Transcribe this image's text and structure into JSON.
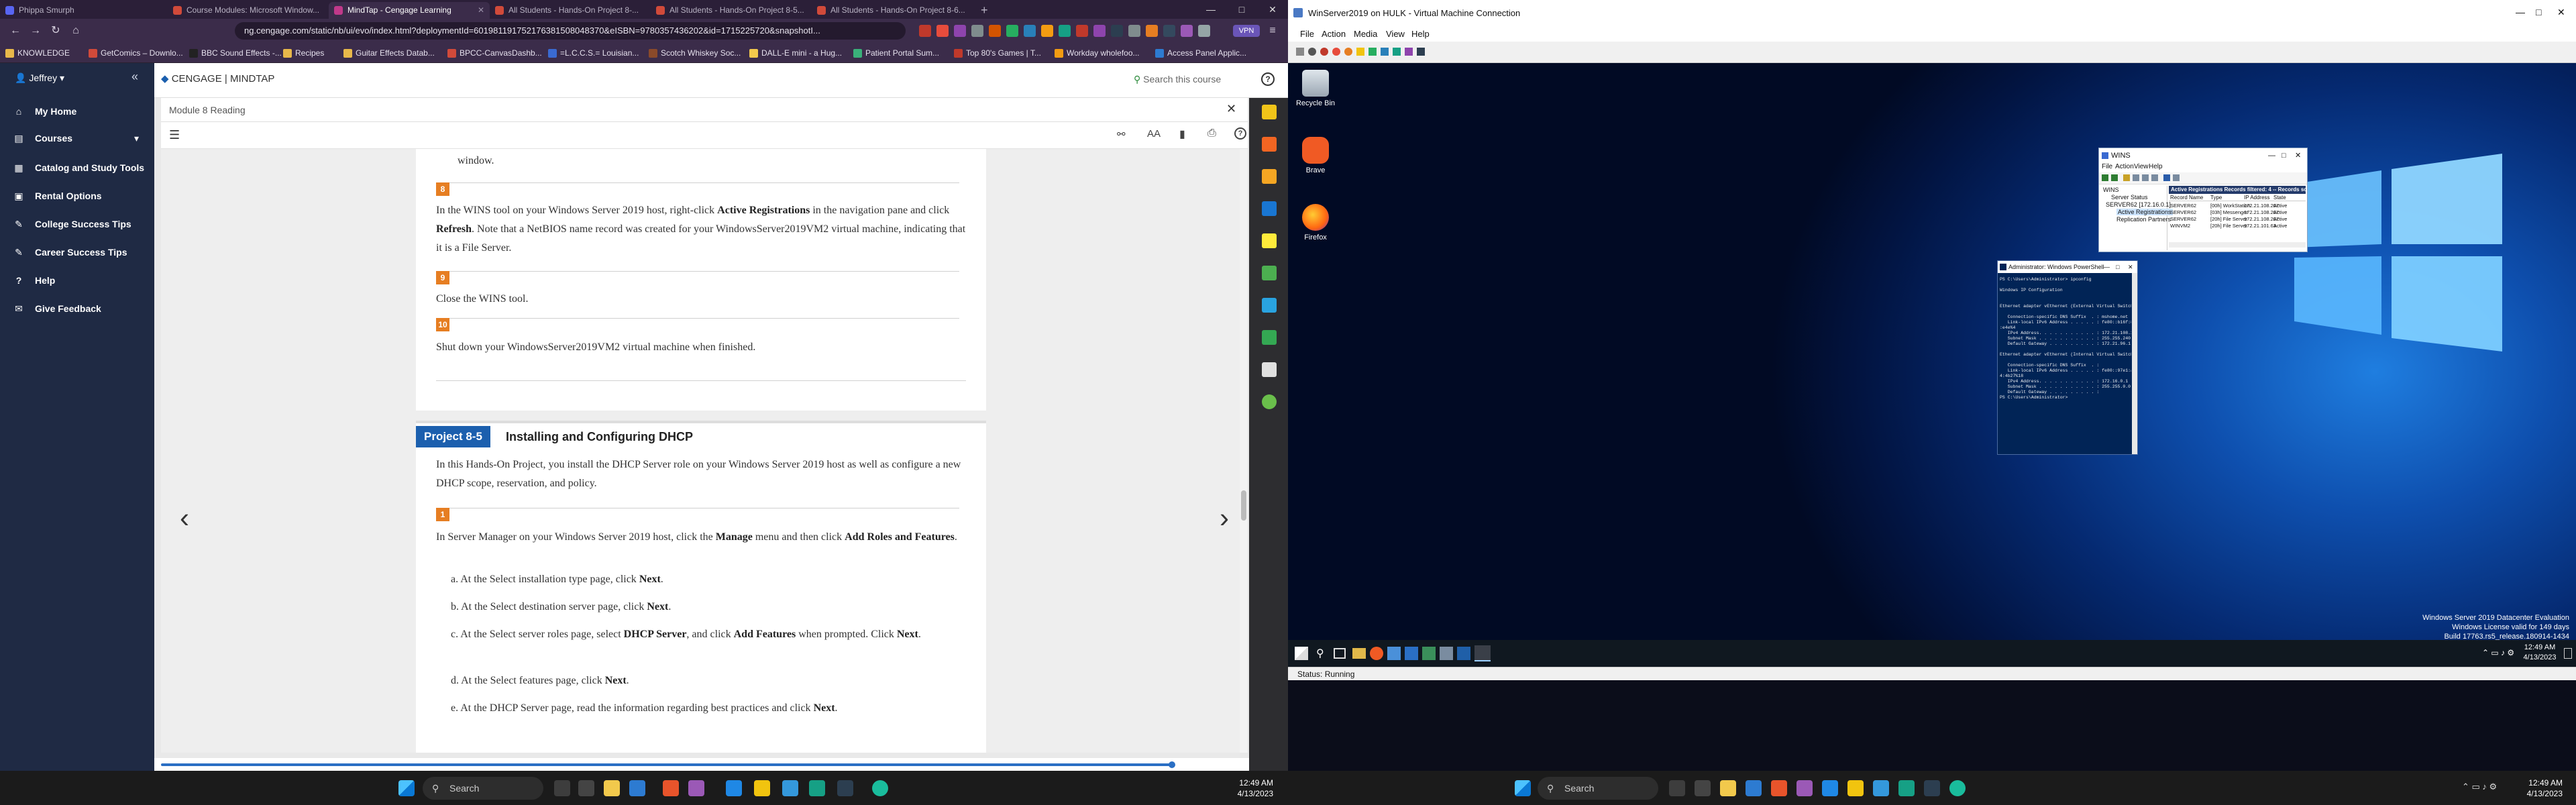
{
  "browser": {
    "tabs": [
      {
        "label": "Phippa Smurph",
        "active": false
      },
      {
        "label": "Course Modules: Microsoft Window...",
        "active": false
      },
      {
        "label": "MindTap - Cengage Learning",
        "active": true
      },
      {
        "label": "All Students - Hands-On Project 8-...",
        "active": false
      },
      {
        "label": "All Students - Hands-On Project 8-5...",
        "active": false
      },
      {
        "label": "All Students - Hands-On Project 8-6...",
        "active": false
      }
    ],
    "new_tab": "+",
    "window_controls": {
      "minimize": "—",
      "maximize": "□",
      "close": "✕"
    },
    "url": "ng.cengage.com/static/nb/ui/evo/index.html?deploymentId=601981191752176381508048370&eISBN=9780357436202&id=1715225720&snapshotI...",
    "vpn_label": "VPN",
    "bookmarks": [
      {
        "label": "KNOWLEDGE",
        "color": "#e8b84a"
      },
      {
        "label": "GetComics – Downlo...",
        "color": "#d14a3a"
      },
      {
        "label": "BBC Sound Effects -...",
        "color": "#222222"
      },
      {
        "label": "Recipes",
        "color": "#e8b84a"
      },
      {
        "label": "Guitar Effects Datab...",
        "color": "#e8b84a"
      },
      {
        "label": "BPCC-CanvasDashb...",
        "color": "#d14a3a"
      },
      {
        "label": "=L.C.C.S.= Louisian...",
        "color": "#3a6ad1"
      },
      {
        "label": "Scotch Whiskey Soc...",
        "color": "#8a4a2a"
      },
      {
        "label": "DALL-E mini - a Hug...",
        "color": "#f2c94c"
      },
      {
        "label": "Patient Portal Sum...",
        "color": "#3ab07a"
      },
      {
        "label": "Top 80's Games | T...",
        "color": "#c0392b"
      },
      {
        "label": "Workday wholefoo...",
        "color": "#f39c12"
      },
      {
        "label": "Access Panel Applic...",
        "color": "#2d7bd1"
      }
    ]
  },
  "mindtap": {
    "logo": "CENGAGE | MINDTAP",
    "search_placeholder": "Search this course",
    "user": "Jeffrey",
    "nav": [
      {
        "label": "My Home",
        "icon": "home-icon"
      },
      {
        "label": "Courses",
        "icon": "book-icon"
      },
      {
        "label": "Catalog and Study Tools",
        "icon": "catalog-icon"
      },
      {
        "label": "Rental Options",
        "icon": "rental-icon"
      },
      {
        "label": "College Success Tips",
        "icon": "tips-icon"
      },
      {
        "label": "Career Success Tips",
        "icon": "career-icon"
      },
      {
        "label": "Help",
        "icon": "help-icon"
      },
      {
        "label": "Give Feedback",
        "icon": "feedback-icon"
      }
    ],
    "reading_title": "Module 8 Reading",
    "close_glyph": "✕",
    "steps_prev": [
      {
        "num": "",
        "text": "window."
      },
      {
        "num": "8",
        "text_html": "In the WINS tool on your Windows Server 2019 host, right-click <b>Active Registrations</b> in the navigation pane and click <b>Refresh</b>. Note that a NetBIOS name record was created for your WindowsServer2019VM2 virtual machine, indicating that it is a File Server."
      },
      {
        "num": "9",
        "text": "Close the WINS tool."
      },
      {
        "num": "10",
        "text": "Shut down your WindowsServer2019VM2 virtual machine when finished."
      }
    ],
    "project_badge": "Project 8-5",
    "project_title": "Installing and Configuring DHCP",
    "project_intro": "In this Hands-On Project, you install the DHCP Server role on your Windows Server 2019 host as well as configure a new DHCP scope, reservation, and policy.",
    "step1_num": "1",
    "step1_html": "In Server Manager on your Windows Server 2019 host, click the <b>Manage</b> menu and then click <b>Add Roles and Features</b>.",
    "substeps_html": [
      "a. At the Select installation type page, click <b>Next</b>.",
      "b. At the Select destination server page, click <b>Next</b>.",
      "c. At the Select server roles page, select <b>DHCP Server</b>, and click <b>Add Features</b> when prompted. Click <b>Next</b>.",
      "d. At the Select features page, click <b>Next</b>.",
      "e. At the DHCP Server page, read the information regarding best practices and click <b>Next</b>."
    ],
    "prev_arrow": "‹",
    "next_arrow": "›",
    "progress": 0.96
  },
  "host_taskbar": {
    "search": "Search",
    "time": "12:49 AM",
    "date": "4/13/2023"
  },
  "vm": {
    "title": "WinServer2019 on HULK - Virtual Machine Connection",
    "menu": [
      "File",
      "Action",
      "Media",
      "View",
      "Help"
    ],
    "desktop_icons": [
      {
        "label": "Recycle Bin"
      },
      {
        "label": "Brave"
      },
      {
        "label": "Firefox"
      }
    ],
    "status": "Status: Running",
    "watermark": [
      "Windows Server 2019 Datacenter Evaluation",
      "Windows License valid for 149 days",
      "Build 17763.rs5_release.180914-1434"
    ],
    "vm_time": "12:49 AM",
    "vm_date": "4/13/2023"
  },
  "wins": {
    "title": "WINS",
    "menu": [
      "File",
      "Action",
      "View",
      "Help"
    ],
    "tree": [
      "WINS",
      "Server Status",
      "SERVER62 [172.16.0.1]",
      "Active Registrations",
      "Replication Partners"
    ],
    "list_header": "Active Registrations    Records filtered: 4 -- Records scanned: 4",
    "columns": [
      "Record Name",
      "Type",
      "IP Address",
      "State"
    ],
    "rows": [
      [
        "SERVER62",
        "[00h] WorkStation",
        "172.21.108.207",
        "Active"
      ],
      [
        "SERVER62",
        "[03h] Messenger",
        "172.21.108.207",
        "Active"
      ],
      [
        "SERVER62",
        "[20h] File Server",
        "172.21.108.207",
        "Active"
      ],
      [
        "WINVM2",
        "[20h] File Server",
        "172.21.101.63",
        "Active"
      ]
    ]
  },
  "powershell": {
    "title": "Administrator: Windows PowerShell",
    "content": "PS C:\\Users\\Administrator> ipconfig\n\nWindows IP Configuration\n\n\nEthernet adapter vEthernet (External Virtual Switch):\n\n   Connection-specific DNS Suffix  . : mshome.net\n   Link-local IPv6 Address . . . . . : fe80::b16f:873:c776\n:e4e%4\n   IPv4 Address. . . . . . . . . . . : 172.21.108.207\n   Subnet Mask . . . . . . . . . . . : 255.255.240.0\n   Default Gateway . . . . . . . . . : 172.21.96.1\n\nEthernet adapter vEthernet (Internal Virtual Switch):\n\n   Connection-specific DNS Suffix  . :\n   Link-local IPv6 Address . . . . . : fe80::97e1:a7d5:4b1\n4:4b27%18\n   IPv4 Address. . . . . . . . . . . : 172.16.0.1\n   Subnet Mask . . . . . . . . . . . : 255.255.0.0\n   Default Gateway . . . . . . . . . :\nPS C:\\Users\\Administrator>"
  },
  "right_taskbar": {
    "search": "Search",
    "time": "12:49 AM",
    "date": "4/13/2023"
  }
}
